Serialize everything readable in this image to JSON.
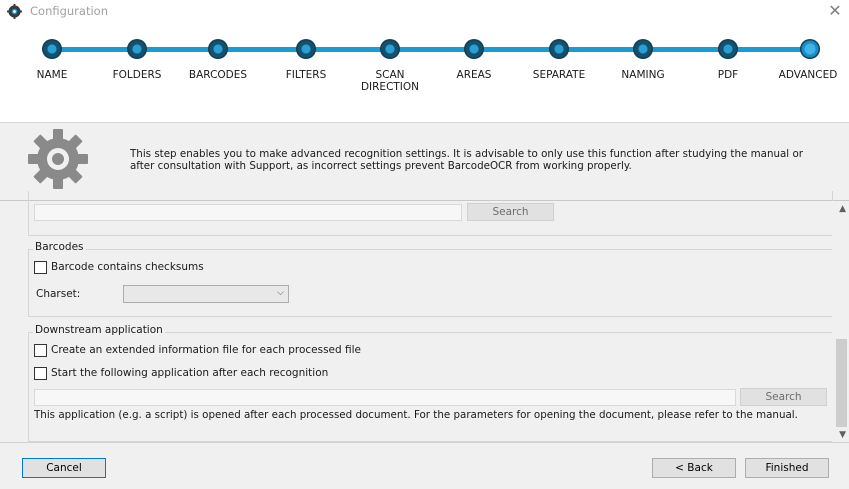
{
  "window": {
    "title": "Configuration",
    "close_glyph": "✕"
  },
  "steps": [
    {
      "label": "NAME"
    },
    {
      "label": "FOLDERS"
    },
    {
      "label": "BARCODES"
    },
    {
      "label": "FILTERS"
    },
    {
      "label": "SCAN DIRECTION"
    },
    {
      "label": "AREAS"
    },
    {
      "label": "SEPARATE"
    },
    {
      "label": "NAMING"
    },
    {
      "label": "PDF"
    },
    {
      "label": "ADVANCED"
    }
  ],
  "info": {
    "icon": "gear-icon",
    "text": "This step enables you to make advanced recognition settings. It is advisable to only use this function after studying the manual or after consultation with Support, as incorrect settings prevent BarcodeOCR from working properly."
  },
  "top_section": {
    "search_value": "",
    "search_button": "Search"
  },
  "barcodes": {
    "legend": "Barcodes",
    "checksum_label": "Barcode contains checksums",
    "checksum_checked": false,
    "charset_label": "Charset:",
    "charset_value": ""
  },
  "downstream": {
    "legend": "Downstream application",
    "extended_info_label": "Create an extended information file for each processed file",
    "extended_info_checked": false,
    "start_app_label": "Start the following application after each recognition",
    "start_app_checked": false,
    "app_path_value": "",
    "search_button": "Search",
    "note": "This application (e.g. a script) is opened after each processed document. For the parameters for opening the document, please refer to the manual."
  },
  "footer": {
    "cancel": "Cancel",
    "back": "< Back",
    "finished": "Finished"
  },
  "colors": {
    "accent": "#1a9bd2",
    "panel_bg": "#f0f0f0"
  }
}
